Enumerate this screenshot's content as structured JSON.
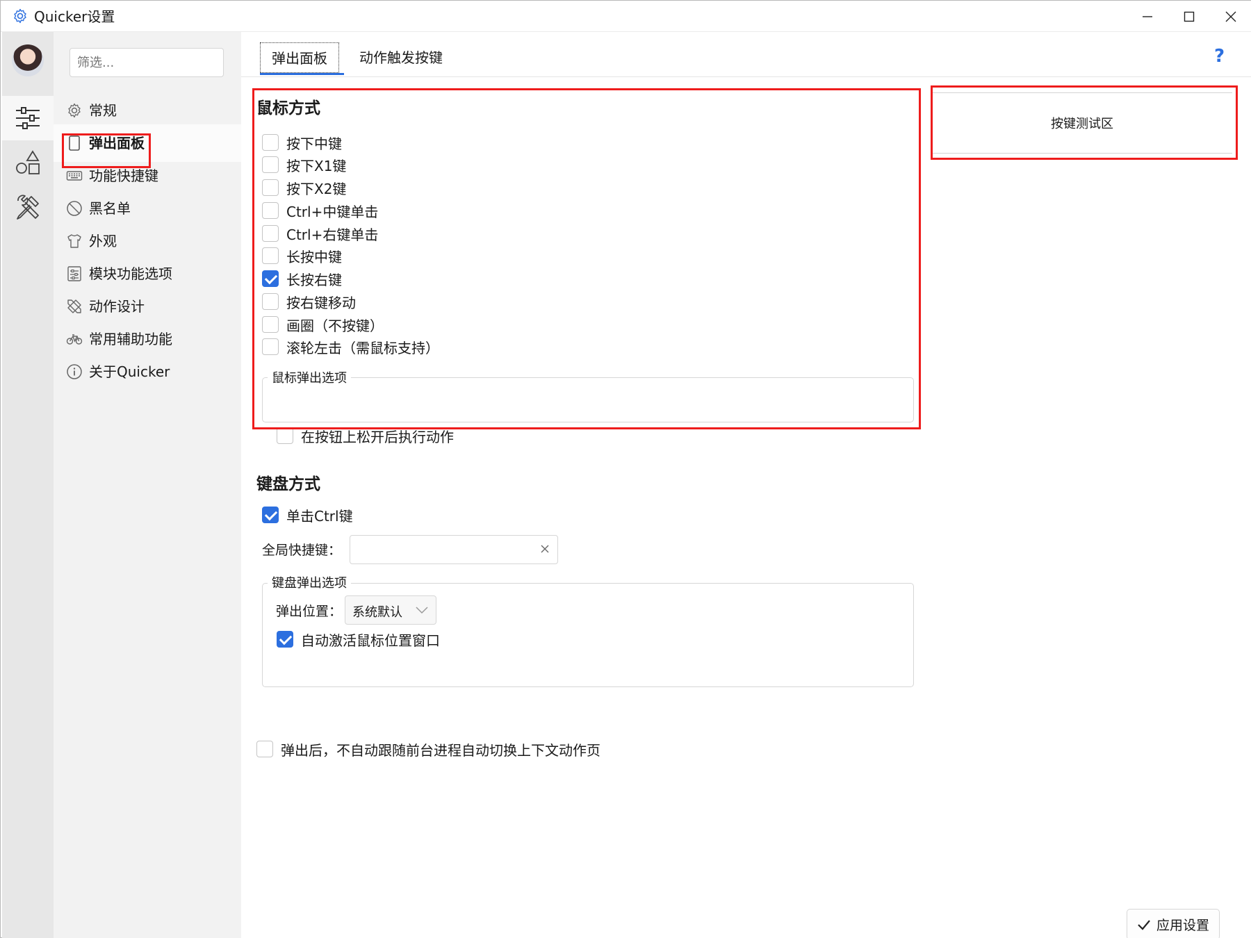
{
  "window": {
    "title": "Quicker设置"
  },
  "nav": {
    "filter_placeholder": "筛选...",
    "items": [
      {
        "label": "常规",
        "icon": "gear-icon"
      },
      {
        "label": "弹出面板",
        "icon": "panel-icon",
        "active": true
      },
      {
        "label": "功能快捷键",
        "icon": "keyboard-icon"
      },
      {
        "label": "黑名单",
        "icon": "ban-icon"
      },
      {
        "label": "外观",
        "icon": "shirt-icon"
      },
      {
        "label": "模块功能选项",
        "icon": "sliders-box-icon"
      },
      {
        "label": "动作设计",
        "icon": "design-tools-icon"
      },
      {
        "label": "常用辅助功能",
        "icon": "bicycle-icon"
      },
      {
        "label": "关于Quicker",
        "icon": "info-icon"
      }
    ]
  },
  "rail": {
    "items": [
      {
        "icon": "settings-sliders-icon",
        "active": true
      },
      {
        "icon": "shapes-icon"
      },
      {
        "icon": "tools-icon"
      }
    ]
  },
  "tabs": [
    {
      "label": "弹出面板",
      "active": true
    },
    {
      "label": "动作触发按键"
    }
  ],
  "help_label": "?",
  "mouse": {
    "title": "鼠标方式",
    "options": [
      {
        "label": "按下中键",
        "checked": false
      },
      {
        "label": "按下X1键",
        "checked": false
      },
      {
        "label": "按下X2键",
        "checked": false
      },
      {
        "label": "Ctrl+中键单击",
        "checked": false
      },
      {
        "label": "Ctrl+右键单击",
        "checked": false
      },
      {
        "label": "长按中键",
        "checked": false
      },
      {
        "label": "长按右键",
        "checked": true
      },
      {
        "label": "按右键移动",
        "checked": false
      },
      {
        "label": "画圈（不按键）",
        "checked": false
      },
      {
        "label": "滚轮左击（需鼠标支持）",
        "checked": false
      }
    ],
    "group_title": "鼠标弹出选项",
    "group_options": [
      {
        "label": "在按钮上松开后执行动作",
        "checked": false
      }
    ]
  },
  "key_test_area": "按键测试区",
  "keyboard": {
    "title": "键盘方式",
    "single_ctrl": {
      "label": "单击Ctrl键",
      "checked": true
    },
    "global_hotkey_label": "全局快捷键：",
    "global_hotkey_value": "",
    "group_title": "键盘弹出选项",
    "popup_position_label": "弹出位置：",
    "popup_position_value": "系统默认",
    "auto_activate": {
      "label": "自动激活鼠标位置窗口",
      "checked": true
    }
  },
  "no_auto_switch": {
    "label": "弹出后，不自动跟随前台进程自动切换上下文动作页",
    "checked": false
  },
  "apply_label": "应用设置",
  "colors": {
    "accent": "#2c6fdf",
    "highlight_border": "#ee1c1c",
    "rail_bg": "#e7e7e7",
    "nav_bg": "#f2f2f2"
  }
}
